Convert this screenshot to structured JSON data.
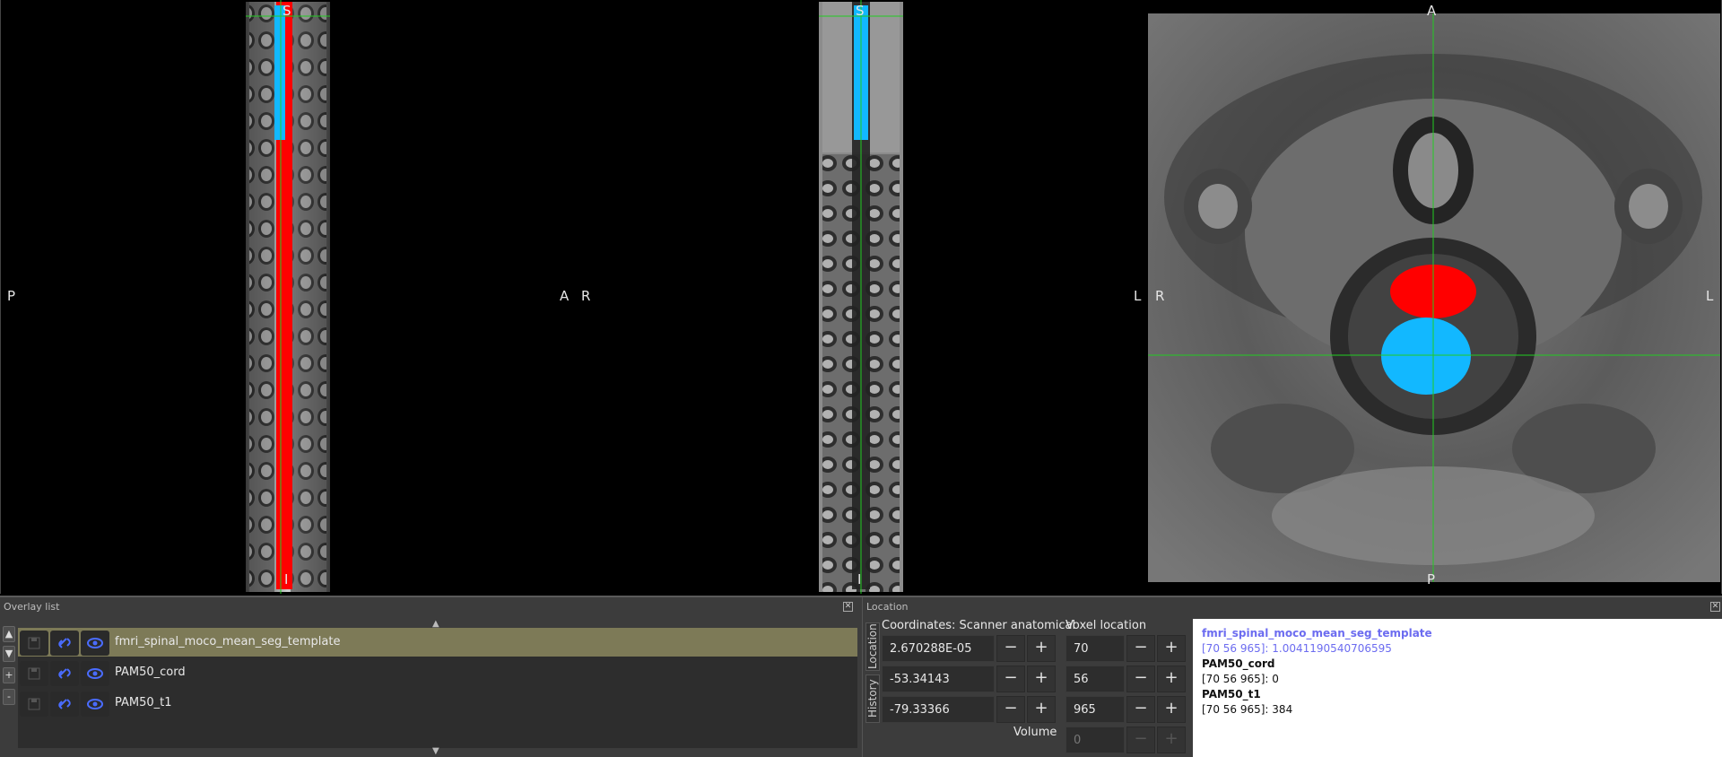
{
  "views": {
    "sagittal": {
      "left_label": "P",
      "right_label": "A",
      "top_label": "S",
      "bottom_label": "I"
    },
    "coronal": {
      "left_label": "R",
      "right_label": "L",
      "top_label": "S",
      "bottom_label": "I"
    },
    "axial": {
      "left_label": "R",
      "right_label": "L",
      "top_label": "A",
      "bottom_label": "P"
    }
  },
  "colors": {
    "crosshair": "#22cc22",
    "cord_seg": "#ff0000",
    "fmri_seg": "#12b8ff",
    "selected_row": "#7d7a57",
    "selected_info_text": "#6c6cf0"
  },
  "overlay_panel": {
    "title": "Overlay list",
    "side_buttons": [
      "▲",
      "▼",
      "+",
      "-"
    ],
    "scroll_up": "▲",
    "scroll_down": "▼",
    "items": [
      {
        "name": "fmri_spinal_moco_mean_seg_template",
        "selected": true
      },
      {
        "name": "PAM50_cord",
        "selected": false
      },
      {
        "name": "PAM50_t1",
        "selected": false
      }
    ]
  },
  "location_panel": {
    "title": "Location",
    "tabs": {
      "location": "Location",
      "history": "History"
    },
    "coords_header": "Coordinates: Scanner anatomical",
    "voxel_header": "Voxel location",
    "coords": [
      "2.670288E-05",
      "-53.34143",
      "-79.33366"
    ],
    "voxels": [
      "70",
      "56",
      "965"
    ],
    "volume_label": "Volume",
    "volume_value": "0",
    "minus": "−",
    "plus": "+"
  },
  "info": [
    {
      "name": "fmri_spinal_moco_mean_seg_template",
      "value": "[70 56 965]: 1.0041190540706595",
      "selected": true
    },
    {
      "name": "PAM50_cord",
      "value": "[70 56 965]: 0",
      "selected": false
    },
    {
      "name": "PAM50_t1",
      "value": "[70 56 965]: 384",
      "selected": false
    }
  ]
}
